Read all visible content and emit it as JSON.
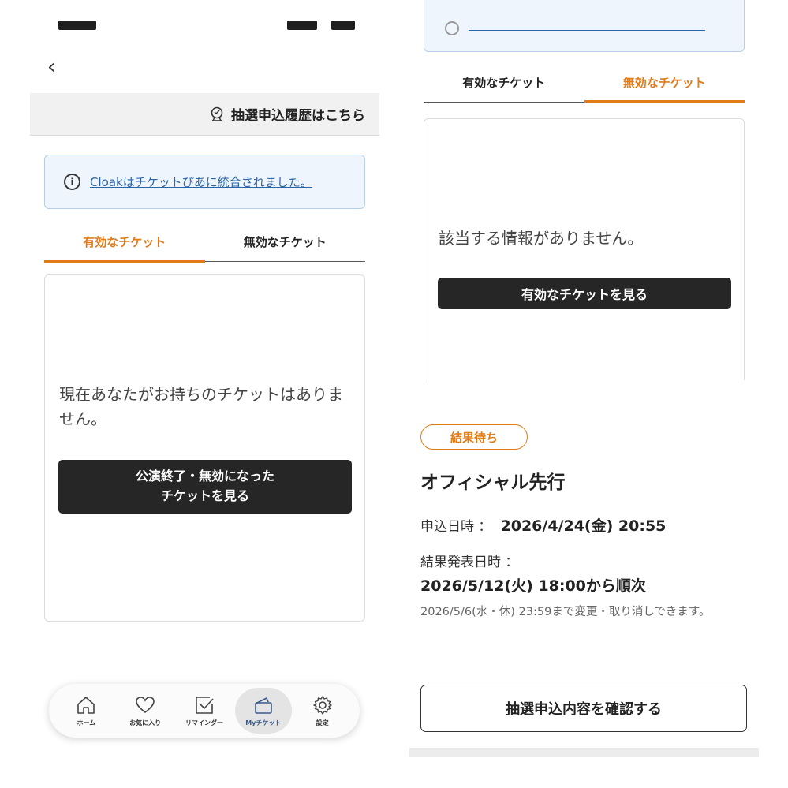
{
  "left": {
    "history_link": "抽選申込履歴はこちら",
    "notice_text": "Cloakはチケットぴあに統合されました。",
    "tabs": [
      {
        "label": "有効なチケット",
        "active": true
      },
      {
        "label": "無効なチケット",
        "active": false
      }
    ],
    "empty_message": "現在あなたがお持ちのチケットはありません。",
    "expired_button_line1": "公演終了・無効になった",
    "expired_button_line2": "チケットを見る",
    "bottom_nav": [
      {
        "label": "ホーム",
        "icon": "home-icon"
      },
      {
        "label": "お気に入り",
        "icon": "heart-icon"
      },
      {
        "label": "リマインダー",
        "icon": "checkbox-icon"
      },
      {
        "label": "Myチケット",
        "icon": "ticket-icon",
        "active": true
      },
      {
        "label": "設定",
        "icon": "gear-icon"
      }
    ]
  },
  "right_top": {
    "tabs": [
      {
        "label": "有効なチケット",
        "active": false
      },
      {
        "label": "無効なチケット",
        "active": true
      }
    ],
    "empty_message": "該当する情報がありません。",
    "valid_button": "有効なチケットを見る"
  },
  "right_bottom": {
    "status_badge": "結果待ち",
    "sale_name": "オフィシャル先行",
    "apply_label": "申込日時 ：",
    "apply_value": "2026/4/24(金) 20:55",
    "result_label": "結果発表日時 ：",
    "result_value": "2026/5/12(火) 18:00から順次",
    "change_note": "2026/5/6(水・休) 23:59まで変更・取り消しできます。",
    "confirm_button": "抽選申込内容を確認する"
  },
  "colors": {
    "accent": "#e07b17",
    "link": "#2c64a8",
    "dark_button": "#262626",
    "notice_bg": "#eef5fd"
  }
}
